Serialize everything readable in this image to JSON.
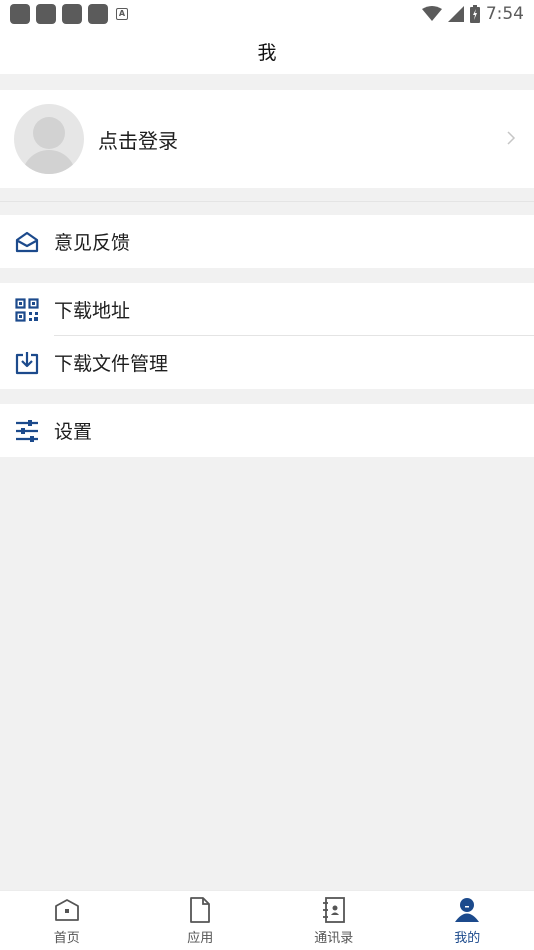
{
  "status_bar": {
    "time": "7:54"
  },
  "header": {
    "title": "我"
  },
  "profile": {
    "login_label": "点击登录"
  },
  "menu": {
    "feedback": {
      "label": "意见反馈",
      "icon": "mail-icon"
    },
    "download_address": {
      "label": "下载地址",
      "icon": "qrcode-icon"
    },
    "download_files": {
      "label": "下载文件管理",
      "icon": "download-icon"
    },
    "settings": {
      "label": "设置",
      "icon": "sliders-icon"
    }
  },
  "tab_bar": {
    "tabs": [
      {
        "label": "首页",
        "icon": "home-icon",
        "active": false
      },
      {
        "label": "应用",
        "icon": "document-icon",
        "active": false
      },
      {
        "label": "通讯录",
        "icon": "contacts-icon",
        "active": false
      },
      {
        "label": "我的",
        "icon": "person-icon",
        "active": true
      }
    ]
  },
  "colors": {
    "accent": "#1c4a8c",
    "background": "#f1f1f1",
    "surface": "#ffffff"
  }
}
